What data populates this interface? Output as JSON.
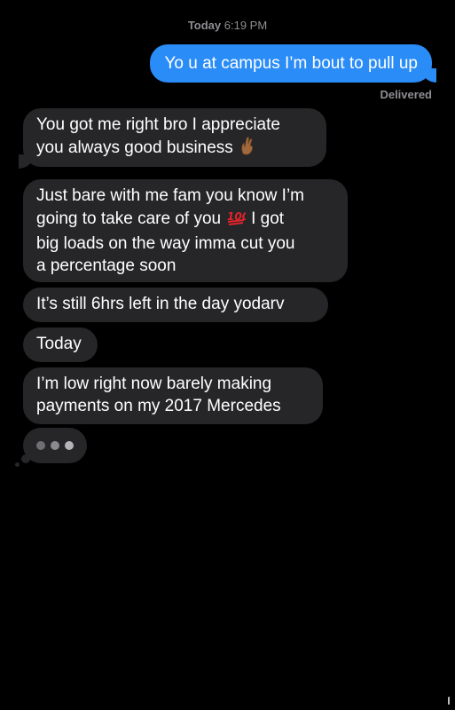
{
  "header": {
    "timestamp_day": "Today",
    "timestamp_time": "6:19 PM"
  },
  "thread": {
    "outgoing": [
      {
        "text": "Yo u at campus I’m bout to pull up"
      }
    ],
    "status": "Delivered",
    "incoming": [
      {
        "lines": [
          "You got me right bro I appreciate",
          "you always good business"
        ],
        "emoji": "crossed-fingers-dark-skin"
      },
      {
        "lines": [
          "Just bare with me fam you know I’m",
          "going to take care of you",
          "big loads on the way imma cut you",
          "a percentage soon"
        ],
        "inline_emoji": "hundred-points",
        "line2_suffix": "I got"
      },
      {
        "lines": [
          "It’s still 6hrs left in the day yodarv"
        ]
      },
      {
        "lines": [
          "Today"
        ]
      },
      {
        "lines": [
          "I’m low right now barely making",
          "payments on my 2017 Mercedes"
        ]
      }
    ],
    "typing_indicator": true
  },
  "colors": {
    "background": "#000000",
    "outgoing_bubble": "#2a8cf6",
    "incoming_bubble": "#262628",
    "meta_text": "#8e8e93"
  }
}
